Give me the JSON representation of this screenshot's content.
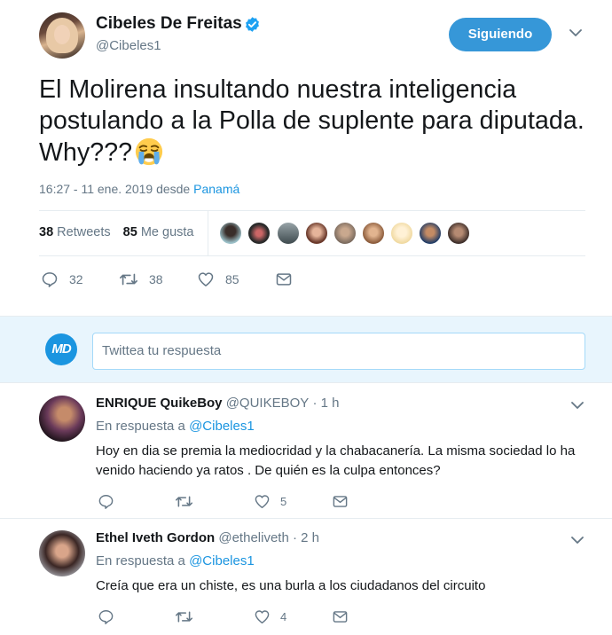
{
  "tweet": {
    "author_name": "Cibeles De Freitas",
    "author_handle": "@Cibeles1",
    "follow_label": "Siguiendo",
    "text": "El Molirena insultando nuestra inteligencia postulando a la Polla de suplente para diputada. Why???",
    "emoji": "loudly-crying-face-emoji",
    "timestamp": "16:27 - 11 ene. 2019",
    "from_label": "desde",
    "place": "Panamá",
    "retweets_count": "38",
    "retweets_label": "Retweets",
    "likes_count": "85",
    "likes_label": "Me gusta",
    "actions": {
      "replies": "32",
      "retweets": "38",
      "likes": "85"
    }
  },
  "compose": {
    "avatar_label": "MD",
    "placeholder": "Twittea tu respuesta"
  },
  "replies": [
    {
      "name": "ENRIQUE QuikeBoy",
      "handle": "@QUIKEBOY",
      "time": "· 1 h",
      "in_reply_prefix": "En respuesta a",
      "in_reply_to": "@Cibeles1",
      "text": "Hoy en dia se premia la mediocridad y la chabacanería. La misma sociedad lo ha venido haciendo ya ratos . De quién es la culpa entonces?",
      "likes": "5"
    },
    {
      "name": "Ethel Iveth Gordon",
      "handle": "@etheliveth",
      "time": "· 2 h",
      "in_reply_prefix": "En respuesta a",
      "in_reply_to": "@Cibeles1",
      "text": "Creía que era un chiste, es una burla  a los ciudadanos del circuito",
      "likes": "4"
    }
  ],
  "colors": {
    "accent": "#1b95e0",
    "follow_button": "#3697d8",
    "secondary_text": "#657786",
    "reply_box_bg": "#e8f5fd"
  }
}
